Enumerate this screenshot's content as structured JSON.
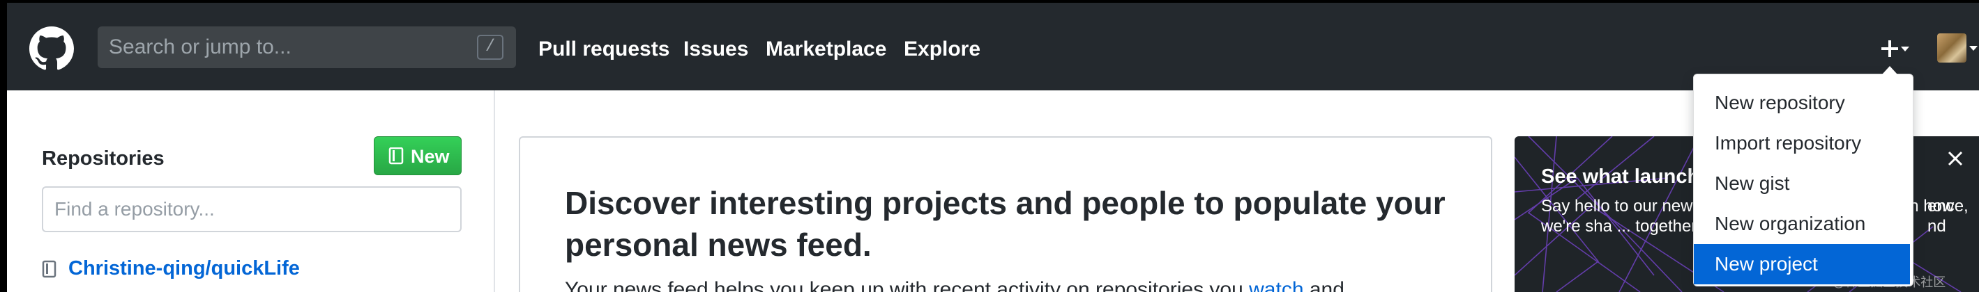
{
  "header": {
    "search_placeholder": "Search or jump to...",
    "search_shortcut": "/",
    "nav": [
      "Pull requests",
      "Issues",
      "Marketplace",
      "Explore"
    ]
  },
  "create_menu": {
    "items": [
      "New repository",
      "Import repository",
      "New gist",
      "New organization",
      "New project"
    ],
    "highlighted_index": 4
  },
  "sidebar": {
    "heading": "Repositories",
    "new_button_label": "New",
    "find_placeholder": "Find a repository...",
    "repos": [
      "Christine-qing/quickLife"
    ]
  },
  "feed": {
    "title": "Discover interesting projects and people to populate your personal news feed.",
    "body_prefix": "Your news feed helps you keep up with recent activity on repositories you",
    "body_link": "watch",
    "body_suffix": "and"
  },
  "promo": {
    "title": "See what launch",
    "text": "Say hello to our new ... get more from GitH ... learn how we're sha ... together.",
    "text_right": "ence, nd",
    "watermark": "@稀土掘金技术社区"
  },
  "colors": {
    "header_bg": "#24292e",
    "link_blue": "#0366d6",
    "new_button_green": "#28a745",
    "menu_highlight": "#0366d6"
  }
}
